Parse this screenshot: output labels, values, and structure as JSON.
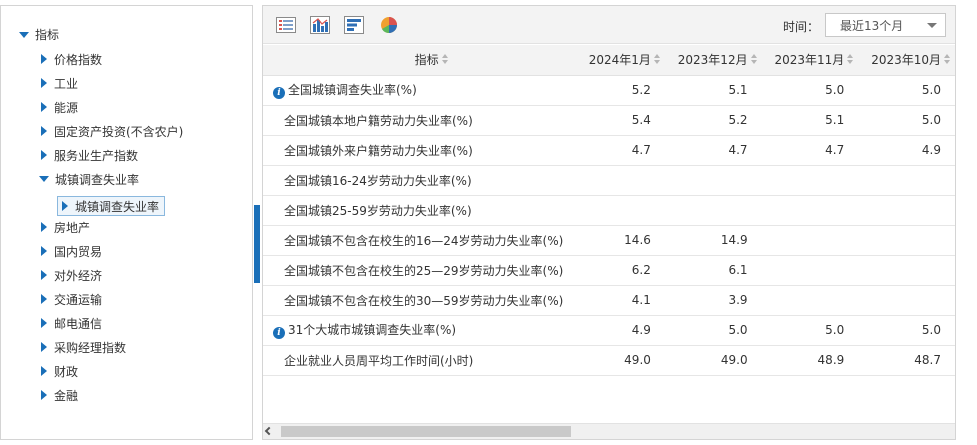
{
  "tree": {
    "root": "指标",
    "items": [
      "价格指数",
      "工业",
      "能源",
      "固定资产投资(不含农户)",
      "服务业生产指数",
      "城镇调查失业率",
      "房地产",
      "国内贸易",
      "对外经济",
      "交通运输",
      "邮电通信",
      "采购经理指数",
      "财政",
      "金融"
    ],
    "expanded_item": "城镇调查失业率",
    "selected_child": "城镇调查失业率"
  },
  "toolbar": {
    "icons": [
      "table-view-icon",
      "bar-chart-icon",
      "horizontal-bar-icon",
      "pie-chart-icon"
    ],
    "time_label": "时间：",
    "time_select_value": "最近13个月"
  },
  "table": {
    "header_indicator": "指标",
    "columns": [
      "2024年1月",
      "2023年12月",
      "2023年11月",
      "2023年10月"
    ],
    "rows": [
      {
        "name": "全国城镇调查失业率(%)",
        "info": true,
        "values": [
          "5.2",
          "5.1",
          "5.0",
          "5.0"
        ]
      },
      {
        "name": "全国城镇本地户籍劳动力失业率(%)",
        "info": false,
        "values": [
          "5.4",
          "5.2",
          "5.1",
          "5.0"
        ]
      },
      {
        "name": "全国城镇外来户籍劳动力失业率(%)",
        "info": false,
        "values": [
          "4.7",
          "4.7",
          "4.7",
          "4.9"
        ]
      },
      {
        "name": "全国城镇16-24岁劳动力失业率(%)",
        "info": false,
        "values": [
          "",
          "",
          "",
          ""
        ]
      },
      {
        "name": "全国城镇25-59岁劳动力失业率(%)",
        "info": false,
        "values": [
          "",
          "",
          "",
          ""
        ]
      },
      {
        "name": "全国城镇不包含在校生的16—24岁劳动力失业率(%)",
        "info": false,
        "values": [
          "14.6",
          "14.9",
          "",
          ""
        ]
      },
      {
        "name": "全国城镇不包含在校生的25—29岁劳动力失业率(%)",
        "info": false,
        "values": [
          "6.2",
          "6.1",
          "",
          ""
        ]
      },
      {
        "name": "全国城镇不包含在校生的30—59岁劳动力失业率(%)",
        "info": false,
        "values": [
          "4.1",
          "3.9",
          "",
          ""
        ]
      },
      {
        "name": "31个大城市城镇调查失业率(%)",
        "info": true,
        "values": [
          "4.9",
          "5.0",
          "5.0",
          "5.0"
        ]
      },
      {
        "name": "企业就业人员周平均工作时间(小时)",
        "info": false,
        "values": [
          "49.0",
          "49.0",
          "48.9",
          "48.7"
        ]
      }
    ]
  },
  "colors": {
    "accent": "#1a6fb8",
    "header_bg": "#f3f3f3",
    "border": "#d4d4d4"
  }
}
